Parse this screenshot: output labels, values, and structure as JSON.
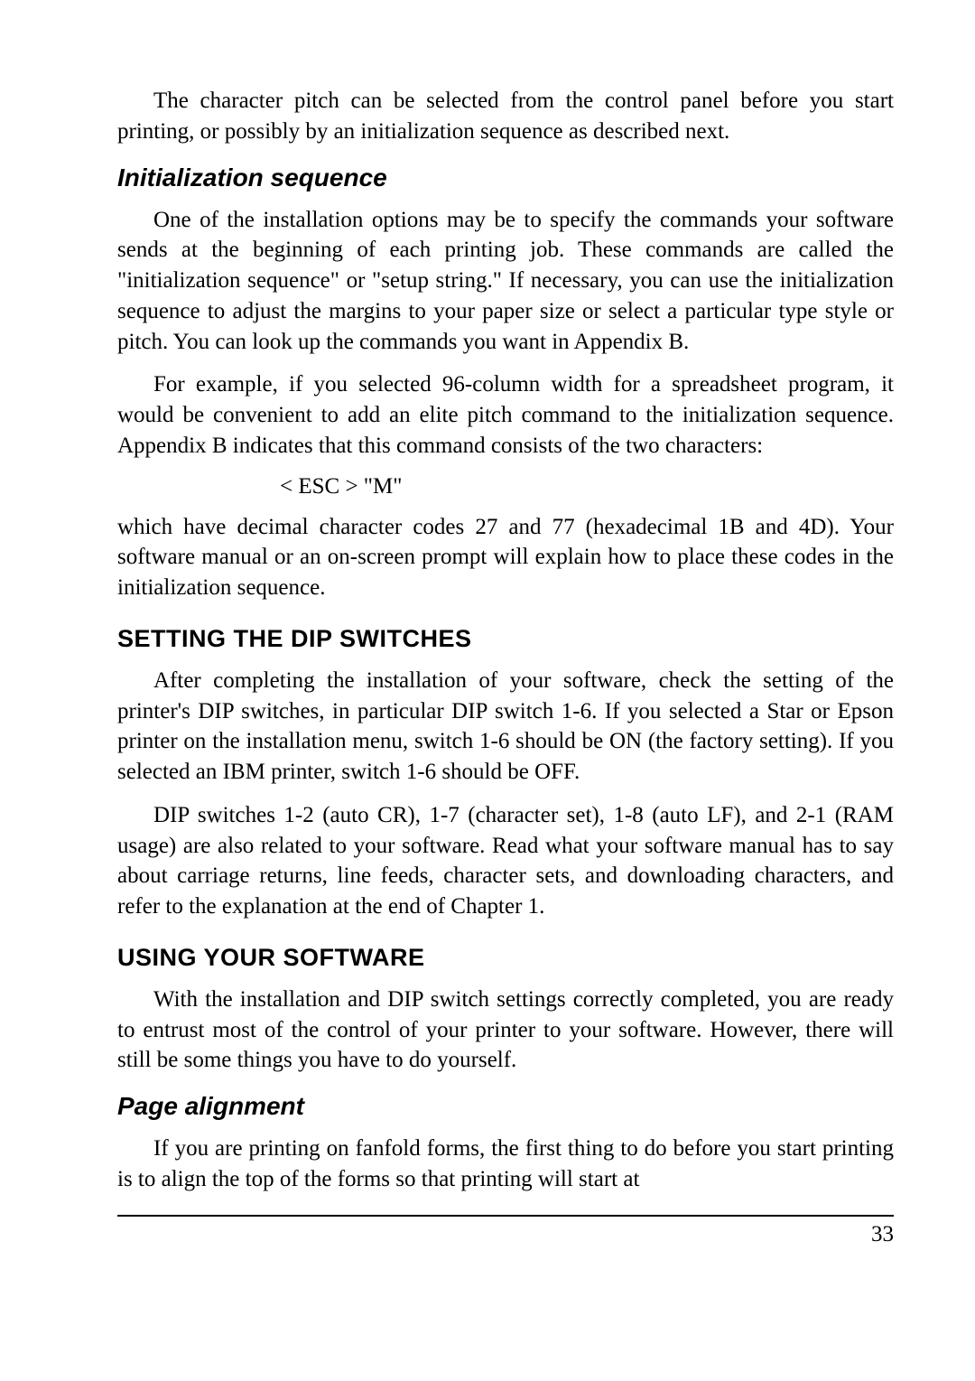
{
  "para_intro": "The character pitch can be selected from the control panel before you start printing, or possibly by an initialization sequence as described next.",
  "heading_init": "Initialization sequence",
  "para_init_1": "One of the installation options may be to specify the commands your software sends at the beginning of each printing job. These commands are called the \"initialization sequence\" or \"setup string.\" If necessary, you can use the initialization sequence to adjust the margins to your paper size or select a particular type style or pitch. You can look up the commands you want in Appendix B.",
  "para_init_2": "For example, if you selected 96-column width for a spreadsheet program, it would be convenient to add an elite pitch command to the initialization sequence. Appendix B indicates that this command consists of the two characters:",
  "code_line": "< ESC >  \"M\"",
  "para_init_3": "which have decimal character codes 27 and 77 (hexadecimal 1B and 4D). Your software manual or an on-screen prompt will explain how to place these codes in the initialization sequence.",
  "heading_dip": "SETTING THE DIP SWITCHES",
  "para_dip_1": "After completing the installation of your software, check the setting of the printer's DIP switches, in particular DIP switch 1-6. If you selected a Star or Epson printer on the installation menu, switch 1-6 should be ON (the factory setting). If you selected an IBM printer, switch 1-6 should be OFF.",
  "para_dip_2": "DIP switches 1-2 (auto CR), 1-7 (character set), 1-8 (auto LF), and 2-1 (RAM usage) are also related to your software. Read what your software manual has to say about carriage returns, line feeds, character sets, and downloading characters, and refer to the explanation at the end of Chapter 1.",
  "heading_using": "USING YOUR SOFTWARE",
  "para_using_1": "With the installation and DIP switch settings correctly completed, you are ready to entrust most of the control of your printer to your software. However, there will still be some things you have to do yourself.",
  "heading_page_align": "Page alignment",
  "para_align_1": "If you are printing on fanfold forms, the first thing to do before you start printing is to align the top of the forms so that printing will start at",
  "page_number": "33"
}
